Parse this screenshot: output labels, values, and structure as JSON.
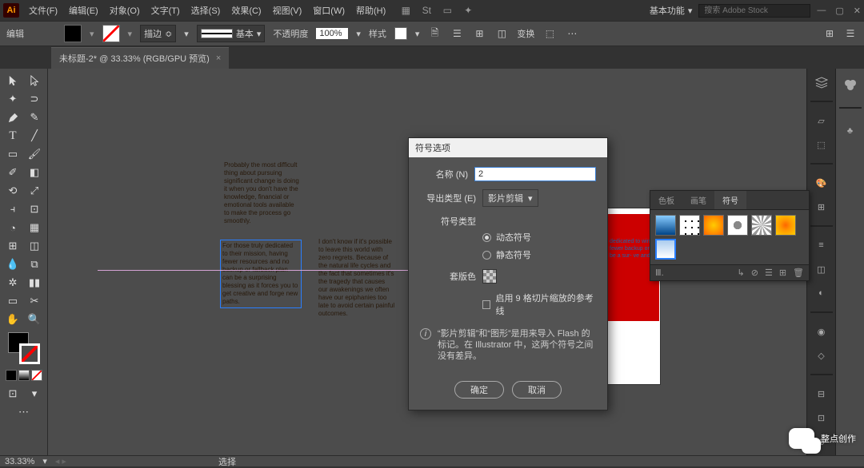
{
  "app": {
    "name": "Ai"
  },
  "menu": {
    "file": "文件(F)",
    "edit": "编辑(E)",
    "object": "对象(O)",
    "type": "文字(T)",
    "select": "选择(S)",
    "effect": "效果(C)",
    "view": "视图(V)",
    "window": "窗口(W)",
    "help": "帮助(H)"
  },
  "top": {
    "workspace": "基本功能",
    "search_ph": "搜索 Adobe Stock"
  },
  "ctrl": {
    "edit": "编辑",
    "stroke_lbl": "描边",
    "basic": "基本",
    "opacity_lbl": "不透明度",
    "opacity": "100%",
    "style_lbl": "样式",
    "transform": "变换"
  },
  "tab": {
    "title": "未标题-2* @ 33.33% (RGB/GPU 预览)"
  },
  "canvas": {
    "block1": "Probably the most difficult thing about pursuing significant change is doing it when you don't have the knowledge, financial or emotional tools available to make the process go smoothly.",
    "block2": "For those truly dedicated to their mission, having fewer resources and no backup or fallback plan can be a surprising blessing as it forces you to get creative and forge new paths.",
    "block3": "I don't know if it's possible to leave this world with zero regrets. Because of the natural life cycles and the fact that sometimes it's the tragedy that causes our awakenings we often have our epiphanies too late to avoid certain painful outcomes.",
    "red": "dedicated to wing fewer backup or be a sur- ve and"
  },
  "dialog": {
    "title": "符号选项",
    "name_lbl": "名称 (N)",
    "name_val": "2",
    "export_lbl": "导出类型 (E)",
    "export_val": "影片剪辑",
    "symtype_lbl": "符号类型",
    "dynamic": "动态符号",
    "static": "静态符号",
    "regcolor_lbl": "套版色",
    "guides": "启用 9 格切片缩放的参考线",
    "info": "“影片剪辑”和“图形”是用来导入 Flash 的标记。在 Illustrator 中，这两个符号之间没有差异。",
    "ok": "确定",
    "cancel": "取消"
  },
  "panel": {
    "tab1": "色板",
    "tab2": "画笔",
    "tab3": "符号",
    "lib": "Ⅲ."
  },
  "status": {
    "zoom": "33.33%",
    "sel": "选择"
  },
  "wechat": {
    "text": "整点创作"
  }
}
